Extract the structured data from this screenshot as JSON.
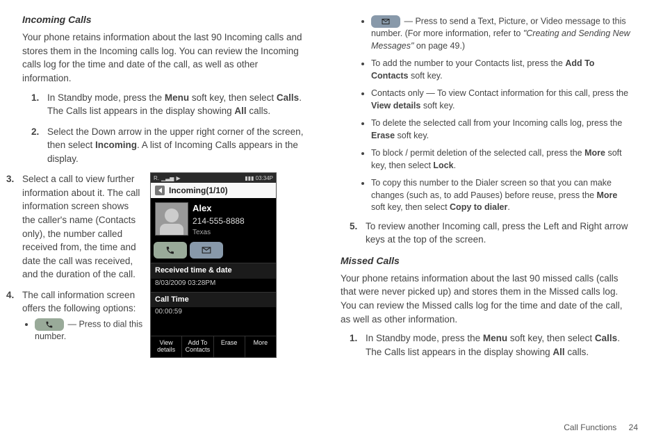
{
  "left": {
    "heading": "Incoming Calls",
    "intro": "Your phone retains information about the last 90 Incoming calls and stores them in the Incoming calls log. You can review the Incoming calls log for the time and date of the call, as well as other information.",
    "step1_a": "In Standby mode, press the ",
    "step1_menu": "Menu",
    "step1_b": " soft key, then select ",
    "step1_calls": "Calls",
    "step1_c": ". The Calls list appears in the display showing ",
    "step1_all": "All",
    "step1_d": " calls.",
    "step2_a": "Select the Down arrow in the upper right corner of the screen, then select ",
    "step2_incoming": "Incoming",
    "step2_b": ". A list of Incoming Calls appears in the display.",
    "step3": "Select a call to view further information about it. The call information screen shows the caller's name (Contacts only), the number called received from, the time and date the call was received, and the duration of the call.",
    "step4": "The call information screen offers the following options:",
    "bullet_dial": " — Press to dial this number."
  },
  "phone": {
    "time": "03:34P",
    "status_indicator": "R.",
    "header": "Incoming(1/10)",
    "name": "Alex",
    "number": "214-555-8888",
    "location": "Texas",
    "recv_lbl": "Received time & date",
    "recv_val": "8/03/2009 03:28PM",
    "dur_lbl": "Call Time",
    "dur_val": "00:00:59",
    "sk1": "View details",
    "sk2": "Add To Contacts",
    "sk3": "Erase",
    "sk4": "More"
  },
  "right": {
    "b1_a": " — Press to send a Text, Picture, or Video message to this number. (For more information, refer to ",
    "b1_ref": "\"Creating and Sending New Messages\"",
    "b1_b": "  on page 49.)",
    "b2_a": "To add the number to your Contacts list, press the ",
    "b2_key": "Add To Contacts",
    "b2_b": " soft key.",
    "b3_a": "Contacts only — To view Contact information for this call, press the ",
    "b3_key": "View details",
    "b3_b": " soft key.",
    "b4_a": "To delete the selected call from your Incoming calls log, press the ",
    "b4_key": "Erase",
    "b4_b": " soft key.",
    "b5_a": "To block / permit deletion of the selected call, press the ",
    "b5_key": "More",
    "b5_b": " soft key, then select ",
    "b5_key2": "Lock",
    "b5_c": ".",
    "b6_a": "To copy this number to the Dialer screen so that you can make changes (such as, to add Pauses) before reuse, press the ",
    "b6_key": "More",
    "b6_b": " soft key, then select ",
    "b6_key2": "Copy to dialer",
    "b6_c": ".",
    "step5": "To review another Incoming call, press the Left and Right arrow keys at the top of the screen.",
    "missed_heading": "Missed Calls",
    "missed_intro": "Your phone retains information about the last 90 missed calls (calls that were never picked up) and stores them in the Missed calls log. You can review the Missed calls log for the time and date of the call, as well as other information.",
    "m1_a": "In Standby mode, press the ",
    "m1_menu": "Menu",
    "m1_b": " soft key, then select ",
    "m1_calls": "Calls",
    "m1_c": ". The Calls list appears in the display showing ",
    "m1_all": "All",
    "m1_d": " calls."
  },
  "footer": {
    "section": "Call Functions",
    "page": "24"
  }
}
